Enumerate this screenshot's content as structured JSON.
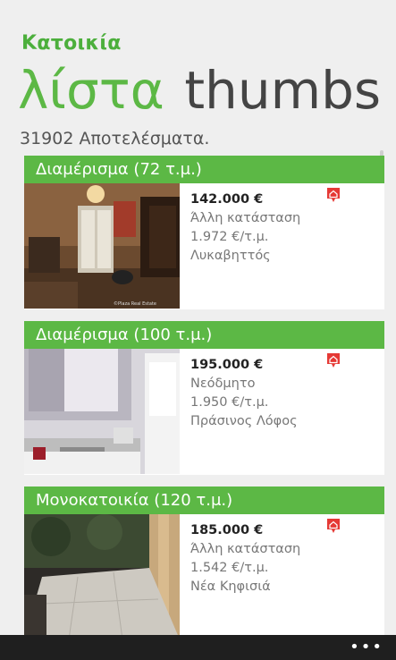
{
  "app": {
    "title": "Κατοικία"
  },
  "pivot": {
    "active": "λίστα",
    "inactive": "thumbs"
  },
  "results": {
    "text": "31902 Αποτελέσματα."
  },
  "listings": [
    {
      "title": "Διαμέρισμα (72 τ.μ.)",
      "price": "142.000 €",
      "condition": "Άλλη κατάσταση",
      "price_per_sqm": "1.972 €/τ.μ.",
      "area": "Λυκαβηττός",
      "watermark": "©Plaza Real Estate",
      "icon": "home-icon"
    },
    {
      "title": "Διαμέρισμα (100 τ.μ.)",
      "price": "195.000 €",
      "condition": "Νεόδμητο",
      "price_per_sqm": "1.950 €/τ.μ.",
      "area": "Πράσινος Λόφος",
      "icon": "home-icon"
    },
    {
      "title": "Μονοκατοικία (120 τ.μ.)",
      "price": "185.000 €",
      "condition": "Άλλη κατάσταση",
      "price_per_sqm": "1.542 €/τ.μ.",
      "area": "Νέα Κηφισιά",
      "icon": "home-icon"
    }
  ],
  "appbar": {
    "more": "•••"
  },
  "colors": {
    "accent": "#5cb845",
    "title_green": "#4caf3c",
    "icon_red": "#e53935",
    "appbar": "#1f1f1f"
  }
}
